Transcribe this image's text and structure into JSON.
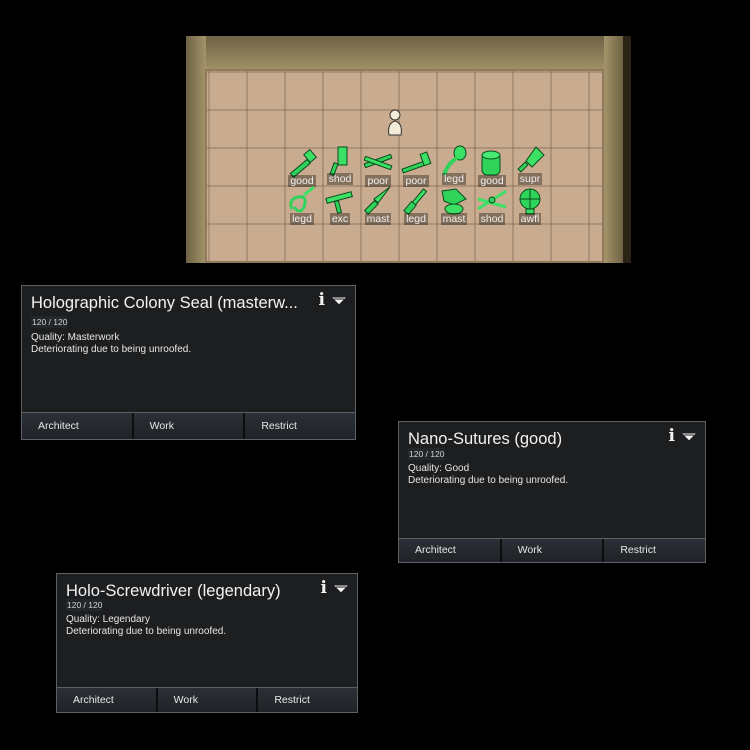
{
  "stockpile": {
    "items": [
      {
        "quality": "good",
        "icon": "hammer-icon",
        "color": "#2fd35a"
      },
      {
        "quality": "shod",
        "icon": "cleaver-icon",
        "color": "#2fd35a"
      },
      {
        "quality": "poor",
        "icon": "crossed-tools-icon",
        "color": "#2fd35a"
      },
      {
        "quality": "poor",
        "icon": "mallet-icon",
        "color": "#2fd35a"
      },
      {
        "quality": "legd",
        "icon": "spoon-icon",
        "color": "#2fd35a"
      },
      {
        "quality": "good",
        "icon": "barrel-icon",
        "color": "#2fd35a"
      },
      {
        "quality": "supr",
        "icon": "trowel-icon",
        "color": "#2fd35a"
      },
      {
        "quality": "legd",
        "icon": "sutures-icon",
        "color": "#2fd35a"
      },
      {
        "quality": "exc",
        "icon": "saw-icon",
        "color": "#2fd35a"
      },
      {
        "quality": "mast",
        "icon": "knife-icon",
        "color": "#2fd35a"
      },
      {
        "quality": "legd",
        "icon": "screwdriver-icon",
        "color": "#2fd35a"
      },
      {
        "quality": "mast",
        "icon": "seal-icon",
        "color": "#2fd35a"
      },
      {
        "quality": "shod",
        "icon": "scissors-icon",
        "color": "#2fd35a"
      },
      {
        "quality": "awfl",
        "icon": "globe-icon",
        "color": "#2fd35a"
      }
    ]
  },
  "panels": [
    {
      "title": "Holographic Colony Seal (masterw...",
      "hp": "120 / 120",
      "quality": "Quality: Masterwork",
      "status": "Deteriorating due to being unroofed.",
      "buttons": [
        "Architect",
        "Work",
        "Restrict"
      ]
    },
    {
      "title": "Nano-Sutures (good)",
      "hp": "120 / 120",
      "quality": "Quality: Good",
      "status": "Deteriorating due to being unroofed.",
      "buttons": [
        "Architect",
        "Work",
        "Restrict"
      ]
    },
    {
      "title": "Holo-Screwdriver (legendary)",
      "hp": "120 / 120",
      "quality": "Quality: Legendary",
      "status": "Deteriorating due to being unroofed.",
      "buttons": [
        "Architect",
        "Work",
        "Restrict"
      ]
    }
  ],
  "icons": {
    "info": "i"
  },
  "colors": {
    "item_green": "#2fd35a",
    "panel_bg": "#1c1e20",
    "floor": "#c9ac90"
  }
}
